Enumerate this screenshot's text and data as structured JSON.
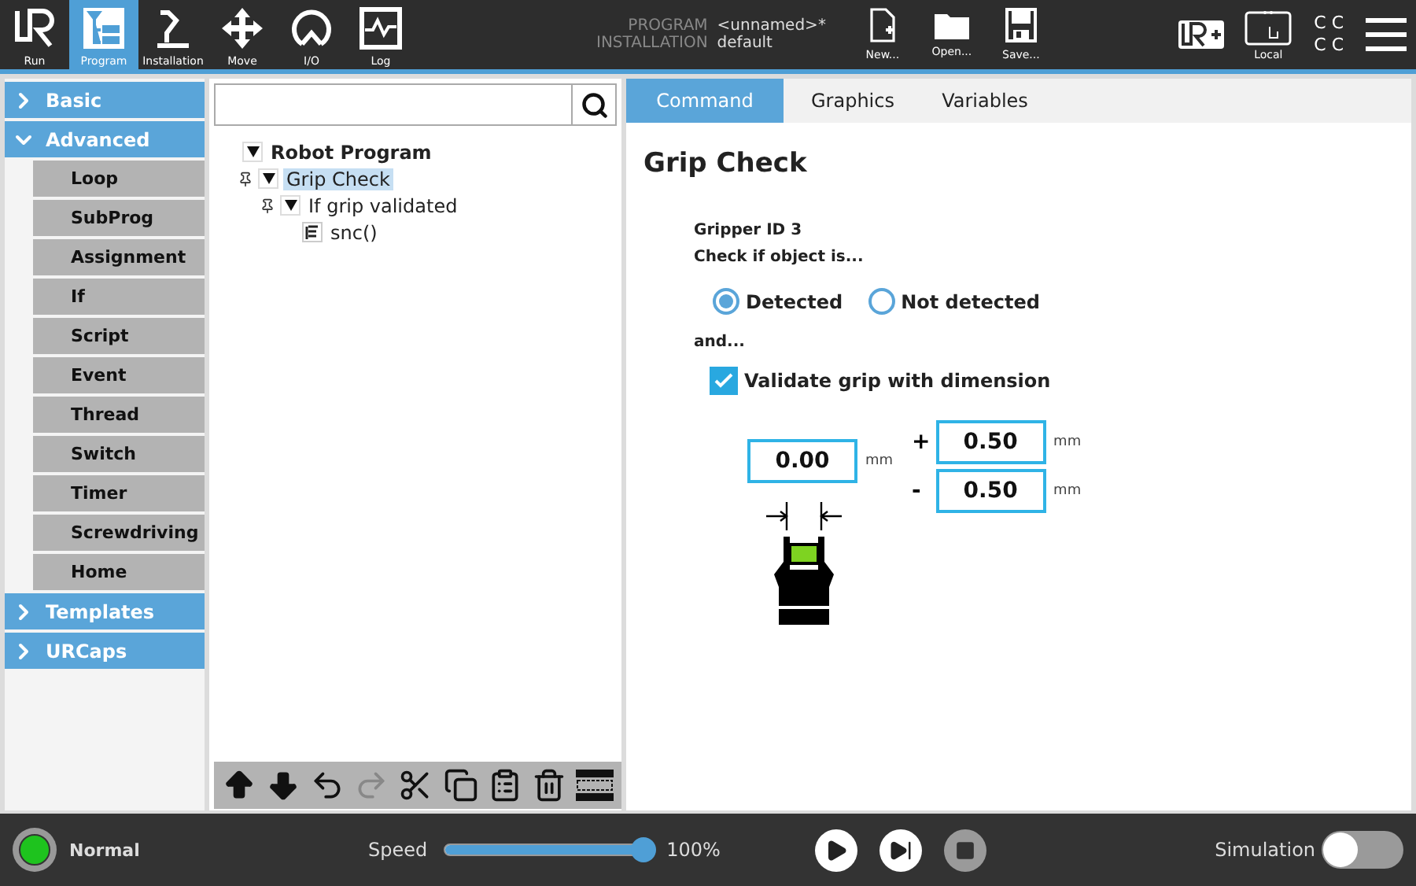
{
  "header": {
    "nav": [
      {
        "label": "Run",
        "kind": "run",
        "selected": false
      },
      {
        "label": "Program",
        "kind": "program",
        "selected": true
      },
      {
        "label": "Installation",
        "kind": "installation",
        "selected": false
      },
      {
        "label": "Move",
        "kind": "move",
        "selected": false
      },
      {
        "label": "I/O",
        "kind": "io",
        "selected": false
      },
      {
        "label": "Log",
        "kind": "log",
        "selected": false
      }
    ],
    "program_label": "PROGRAM",
    "program_value": "<unnamed>*",
    "installation_label": "INSTALLATION",
    "installation_value": "default",
    "file_buttons": [
      {
        "label": "New...",
        "kind": "new"
      },
      {
        "label": "Open...",
        "kind": "open"
      },
      {
        "label": "Save...",
        "kind": "save"
      }
    ],
    "local_label": "Local",
    "speed_marks": [
      "C C",
      "C C"
    ]
  },
  "sidebar": [
    {
      "label": "Basic",
      "expanded": false
    },
    {
      "label": "Advanced",
      "expanded": true,
      "items": [
        "Loop",
        "SubProg",
        "Assignment",
        "If",
        "Script",
        "Event",
        "Thread",
        "Switch",
        "Timer",
        "Screwdriving",
        "Home"
      ]
    },
    {
      "label": "Templates",
      "expanded": false
    },
    {
      "label": "URCaps",
      "expanded": false
    }
  ],
  "tree": {
    "nodes": [
      {
        "label": "Robot Program",
        "expanded": true,
        "selected": false,
        "children": [
          {
            "label": "Grip Check",
            "expanded": true,
            "selected": true,
            "children": [
              {
                "label": "If grip validated",
                "expanded": true,
                "selected": false,
                "children": [
                  {
                    "label": "snc()",
                    "selected": false
                  }
                ]
              }
            ]
          }
        ]
      }
    ],
    "toolbar": [
      {
        "kind": "up",
        "disabled": false
      },
      {
        "kind": "down",
        "disabled": false
      },
      {
        "kind": "undo",
        "disabled": false
      },
      {
        "kind": "redo",
        "disabled": true
      },
      {
        "kind": "cut",
        "disabled": false
      },
      {
        "kind": "copy",
        "disabled": false
      },
      {
        "kind": "paste",
        "disabled": false
      },
      {
        "kind": "delete",
        "disabled": false
      },
      {
        "kind": "suppress",
        "disabled": false
      }
    ]
  },
  "tabs": [
    {
      "label": "Command",
      "selected": true
    },
    {
      "label": "Graphics",
      "selected": false
    },
    {
      "label": "Variables",
      "selected": false
    }
  ],
  "command": {
    "title": "Grip Check",
    "gripper": "Gripper ID 3",
    "question": "Check if object is...",
    "options": [
      {
        "label": "Detected",
        "selected": true
      },
      {
        "label": "Not detected",
        "selected": false
      }
    ],
    "and": "and...",
    "validate": {
      "label": "Validate grip with dimension",
      "checked": true
    },
    "dimension": {
      "value": "0.00",
      "unit": "mm"
    },
    "tolerances": [
      {
        "sign": "+",
        "value": "0.50",
        "unit": "mm"
      },
      {
        "sign": "-",
        "value": "0.50",
        "unit": "mm"
      }
    ]
  },
  "footer": {
    "status": {
      "label": "Normal",
      "color": "#1ec31e"
    },
    "speed_label": "Speed",
    "speed": {
      "level": 1.0
    },
    "speed_reading": "100%",
    "controls": [
      {
        "kind": "play",
        "disabled": false
      },
      {
        "kind": "step",
        "disabled": false
      },
      {
        "kind": "stop",
        "disabled": true
      }
    ],
    "simulation_label": "Simulation",
    "simulation": {
      "on": false
    }
  }
}
